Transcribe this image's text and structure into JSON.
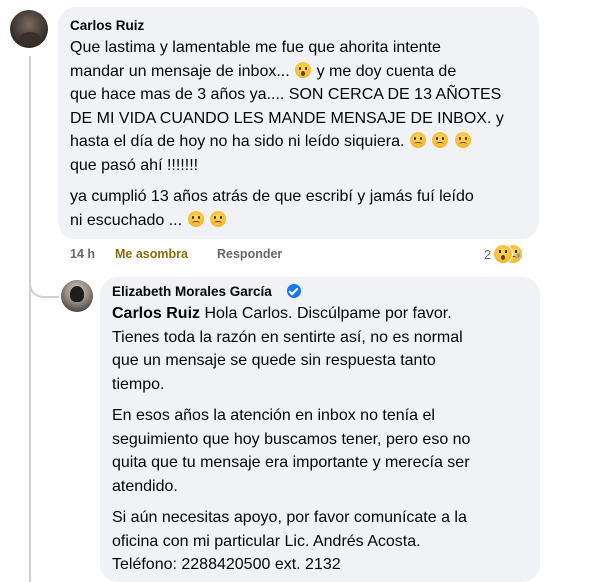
{
  "comment": {
    "author": "Carlos Ruiz",
    "p1_l1": "Que lastima y lamentable me fue que ahorita intente",
    "p1_l2a": "mandar un mensaje de inbox... ",
    "p1_l2b": " y me doy cuenta de",
    "p1_l3": "que hace mas de 3 años ya.... SON CERCA DE 13 AÑOTES",
    "p1_l4": "DE MI VIDA CUANDO LES MANDE MENSAJE DE INBOX. y",
    "p1_l5": "hasta el día de hoy no ha sido ni leído siquiera. ",
    "p1_l6": "que pasó ahí !!!!!!!",
    "p2_l1": "ya cumplió 13 años atrás de que escribí y jamás fuí leído",
    "p2_l2": "ni escuchado ... ",
    "time": "14 h",
    "reaction_label": "Me asombra",
    "reply_label": "Responder",
    "reaction_count": "2",
    "reaction_icons": [
      "wow-icon",
      "sad-icon"
    ]
  },
  "reply": {
    "author": "Elizabeth Morales García",
    "mention": "Carlos Ruiz",
    "p1_l1": " Hola Carlos. Discúlpame por favor.",
    "p1_l2": "Tienes toda la razón en sentirte así, no es normal",
    "p1_l3": "que un mensaje se quede sin respuesta tanto",
    "p1_l4": "tiempo.",
    "p2_l1": "En esos años la atención en inbox no tenía el",
    "p2_l2": "seguimiento que hoy buscamos tener, pero eso no",
    "p2_l3": "quita que tu mensaje era importante y merecía ser",
    "p2_l4": "atendido.",
    "p3_l1": "Si aún necesitas apoyo, por favor comunícate a la",
    "p3_l2": "oficina con mi particular Lic. Andrés Acosta.",
    "p3_l3": "Teléfono: 2288420500 ext. 2132"
  },
  "colors": {
    "bubble": "#f0f2f5",
    "muted": "#65676b",
    "wow_reaction": "#8a6d10",
    "verified": "#1877f2"
  }
}
